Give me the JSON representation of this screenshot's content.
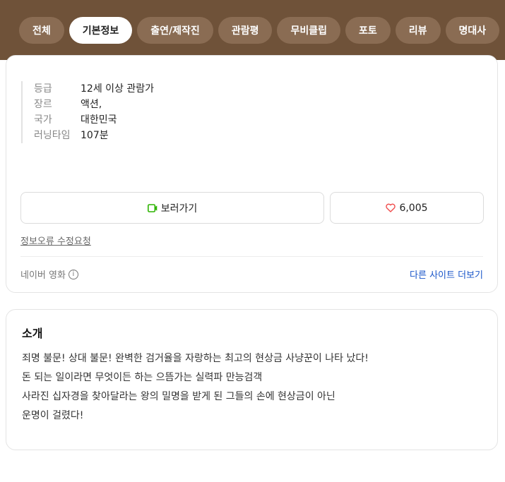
{
  "tabs": [
    {
      "label": "전체"
    },
    {
      "label": "기본정보",
      "active": true
    },
    {
      "label": "출연/제작진"
    },
    {
      "label": "관람평"
    },
    {
      "label": "무비클립"
    },
    {
      "label": "포토"
    },
    {
      "label": "리뷰"
    },
    {
      "label": "명대사"
    }
  ],
  "info": {
    "rows": [
      {
        "key": "등급",
        "value": "12세 이상 관람가"
      },
      {
        "key": "장르",
        "value": "액션,"
      },
      {
        "key": "국가",
        "value": "대한민국"
      },
      {
        "key": "러닝타임",
        "value": "107분"
      }
    ],
    "watch_label": "보러가기",
    "like_count": "6,005",
    "report_link": "정보오류 수정요청",
    "source_label": "네이버 영화",
    "info_icon_glyph": "i",
    "more_sites_link": "다른 사이트 더보기"
  },
  "intro": {
    "title": "소개",
    "lines": [
      "죄명 불문! 상대 불문! 완벽한 검거율을 자랑하는 최고의 현상금 사냥꾼이 나타 났다!",
      "돈 되는 일이라면 무엇이든 하는 으뜸가는 실력파 만능검객",
      "사라진 십자경을 찾아달라는 왕의 밀명을 받게 된 그들의 손에 현상금이 아닌",
      "운명이 걸렸다!"
    ]
  },
  "colors": {
    "band": "#6f5239",
    "tab_bg": "#8a6c53",
    "watch_icon": "#2db400",
    "heart": "#f04b4b",
    "link": "#1a56c9"
  },
  "icons": {
    "watch": "play-screen-icon",
    "like": "heart-icon",
    "source_info": "info-circle-icon"
  }
}
